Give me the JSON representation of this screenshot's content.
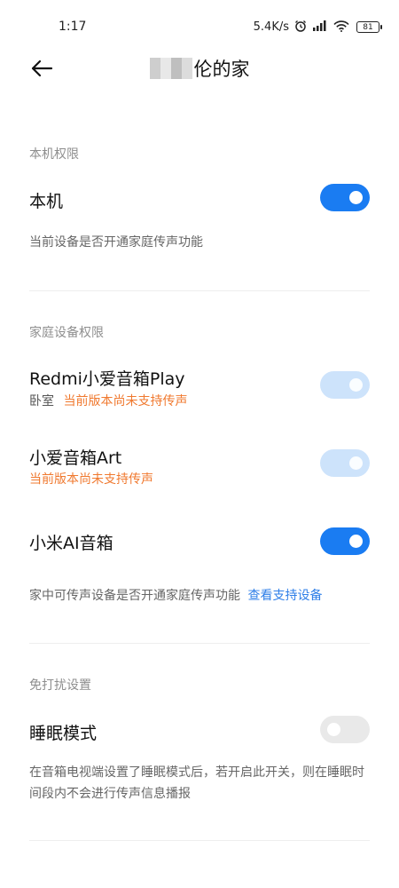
{
  "status_bar": {
    "time": "1:17",
    "speed": "5.4K/s",
    "battery": "81"
  },
  "header": {
    "title_suffix": "伦的家"
  },
  "local": {
    "section": "本机权限",
    "row_title": "本机",
    "toggle_state": "on",
    "note": "当前设备是否开通家庭传声功能"
  },
  "home_devices": {
    "section": "家庭设备权限",
    "devices": [
      {
        "name": "Redmi小爱音箱Play",
        "room": "卧室",
        "status": "当前版本尚未支持传声",
        "toggle_state": "disabled-on"
      },
      {
        "name": "小爱音箱Art",
        "status": "当前版本尚未支持传声",
        "toggle_state": "disabled-on"
      },
      {
        "name": "小米AI音箱",
        "toggle_state": "on"
      }
    ],
    "note": "家中可传声设备是否开通家庭传声功能",
    "note_link": "查看支持设备"
  },
  "dnd": {
    "section": "免打扰设置",
    "row_title": "睡眠模式",
    "toggle_state": "off",
    "note": "在音箱电视端设置了睡眠模式后，若开启此开关，则在睡眠时间段内不会进行传声信息播报"
  },
  "colors": {
    "accent": "#1a7cf2",
    "warning": "#f0792f",
    "link": "#2f7fe8"
  }
}
